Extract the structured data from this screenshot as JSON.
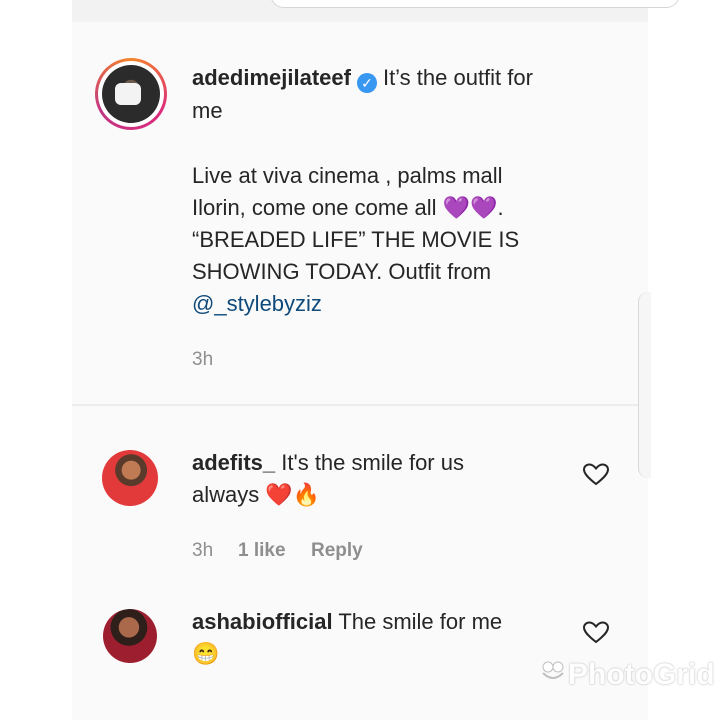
{
  "caption": {
    "username": "adedimejilateef",
    "first_line_text": "It’s the outfit for",
    "second_line_text": "me",
    "body_lines": [
      "Live at viva cinema , palms mall",
      "Ilorin, come one come all 💜💜.",
      "“BREADED LIFE” THE MOVIE IS",
      "SHOWING TODAY. Outfit from"
    ],
    "mention": "@_stylebyziz",
    "time": "3h"
  },
  "comments": [
    {
      "username": "adefits_",
      "text_line1": "It's the smile for us",
      "text_line2": "always ❤️🔥",
      "time": "3h",
      "likes": "1 like",
      "reply": "Reply"
    },
    {
      "username": "ashabiofficial",
      "text_line1": "The smile for me",
      "text_line2": "😁"
    }
  ],
  "watermark": {
    "label": "PhotoGrid"
  },
  "icons": {
    "verified": "verified-badge-icon",
    "heart": "heart-outline-icon"
  },
  "colors": {
    "text": "#262626",
    "meta": "#8e8e8e",
    "verified": "#3897f0",
    "mention": "#0f4a7a"
  }
}
